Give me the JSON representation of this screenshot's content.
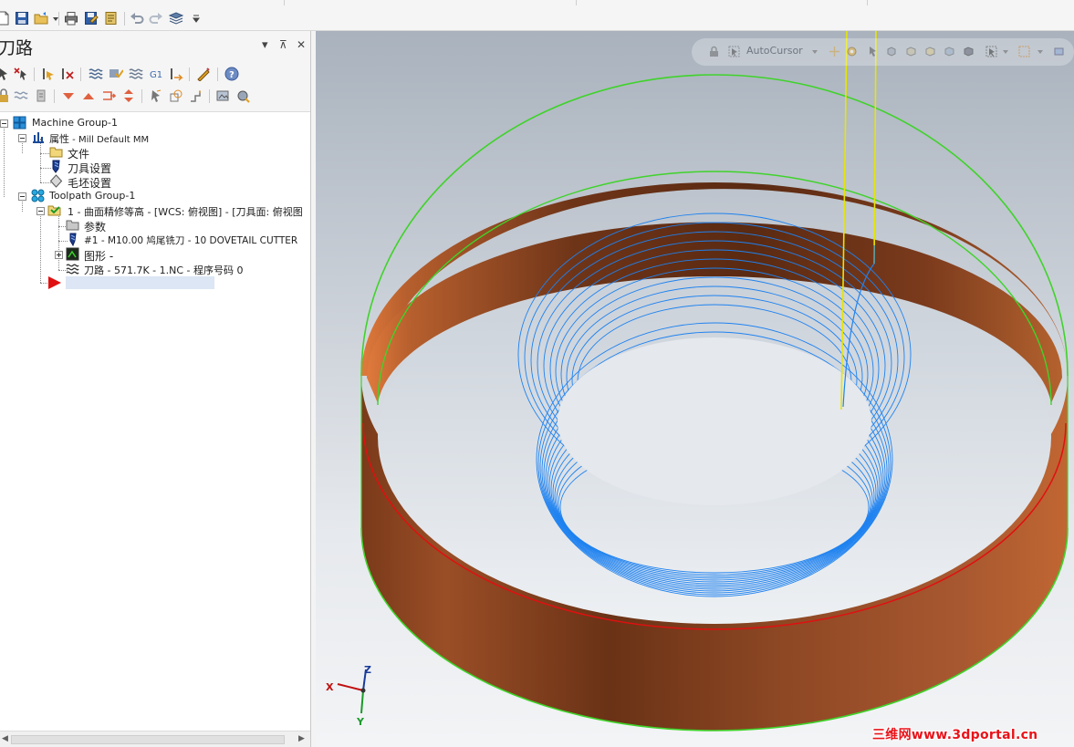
{
  "qat": {
    "icons": [
      "new-file-icon",
      "save-icon",
      "open-folder-icon",
      "dropdown-arrow-icon",
      "print-icon",
      "save-as-icon",
      "properties-icon",
      "undo-icon",
      "redo-icon",
      "layers-icon",
      "customize-icon"
    ]
  },
  "panel": {
    "title": "刀路",
    "pin_glyph": "⊼",
    "close_glyph": "✕",
    "dropdown_glyph": "▾"
  },
  "tree": {
    "machine_group": "Machine Group-1",
    "properties_label": "属性",
    "properties_detail": " - Mill Default MM",
    "files_label": "文件",
    "tool_settings_label": "刀具设置",
    "stock_settings_label": "毛坯设置",
    "toolpath_group": "Toolpath Group-1",
    "operation_label": "1 - 曲面精修等高 - [WCS: 俯视图] - [刀具面: 俯视图",
    "parameters_label": "参数",
    "tool_label": "#1 - M10.00 鸠尾铣刀 - 10 DOVETAIL CUTTER",
    "geometry_label": "图形 -",
    "toolpath_label": "刀路 - 571.7K - 1.NC - 程序号码 0"
  },
  "viewport": {
    "autocursor_label": "AutoCursor",
    "axis_x": "X",
    "axis_y": "Y",
    "axis_z": "Z",
    "watermark": "三维网www.3dportal.cn",
    "colors": {
      "ring_dark": "#5a2a12",
      "ring_mid": "#8a4422",
      "ring_light": "#c4642e",
      "edge_green": "#3fd32a",
      "toolpath_blue": "#1e82f0",
      "red_line": "#e01010",
      "yellow_line": "#e6e600"
    }
  }
}
